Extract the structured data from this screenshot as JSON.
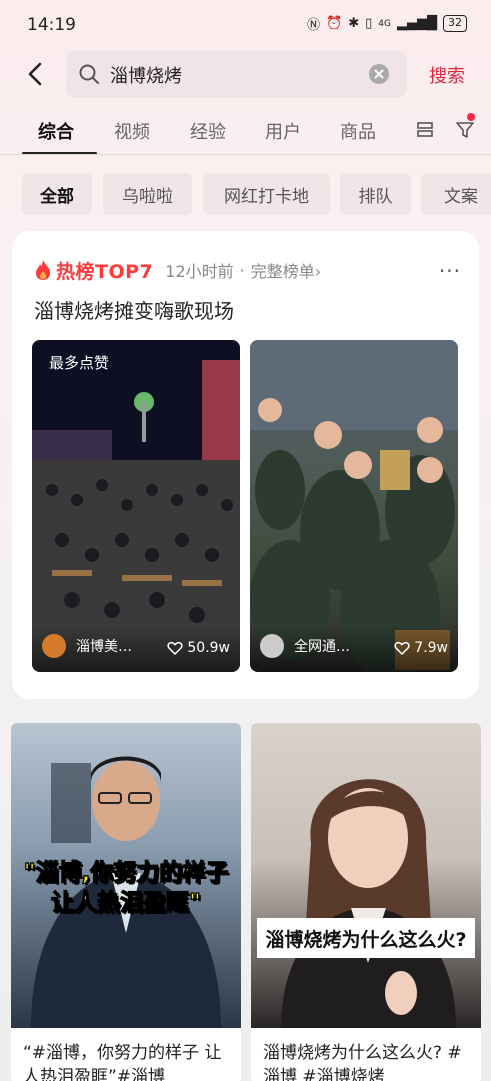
{
  "status": {
    "time": "14:19",
    "network": "4G",
    "battery": "32"
  },
  "search": {
    "query": "淄博烧烤",
    "submit_label": "搜索"
  },
  "tabs": [
    {
      "label": "综合",
      "active": true
    },
    {
      "label": "视频",
      "active": false
    },
    {
      "label": "经验",
      "active": false
    },
    {
      "label": "用户",
      "active": false
    },
    {
      "label": "商品",
      "active": false
    }
  ],
  "chips": [
    {
      "label": "全部",
      "active": true
    },
    {
      "label": "乌啦啦",
      "active": false
    },
    {
      "label": "网红打卡地",
      "active": false
    },
    {
      "label": "排队",
      "active": false
    },
    {
      "label": "文案",
      "active": false
    }
  ],
  "hot": {
    "badge": "热榜TOP7",
    "time": "12小时前",
    "separator": "·",
    "link": "完整榜单",
    "link_arrow": "›",
    "more": "···",
    "headline": "淄博烧烤摊变嗨歌现场",
    "items": [
      {
        "badge": "最多点赞",
        "author": "淄博美…",
        "likes": "50.9w"
      },
      {
        "badge": "",
        "author": "全网通…",
        "likes": "7.9w"
      }
    ]
  },
  "feed": [
    {
      "overlay": "\"淄博,你努力的样子\n让人热泪盈眶\"",
      "title": "“#淄博，你努力的样子 让人热泪盈眶”#淄博"
    },
    {
      "overlay": "淄博烧烤为什么这么火?",
      "title": "淄博烧烤为什么这么火? #淄博 #淄博烧烤"
    }
  ],
  "colors": {
    "accent": "#e2253d",
    "hot_red": "#ff3b3b",
    "overlay_yellow": "#fff200"
  }
}
